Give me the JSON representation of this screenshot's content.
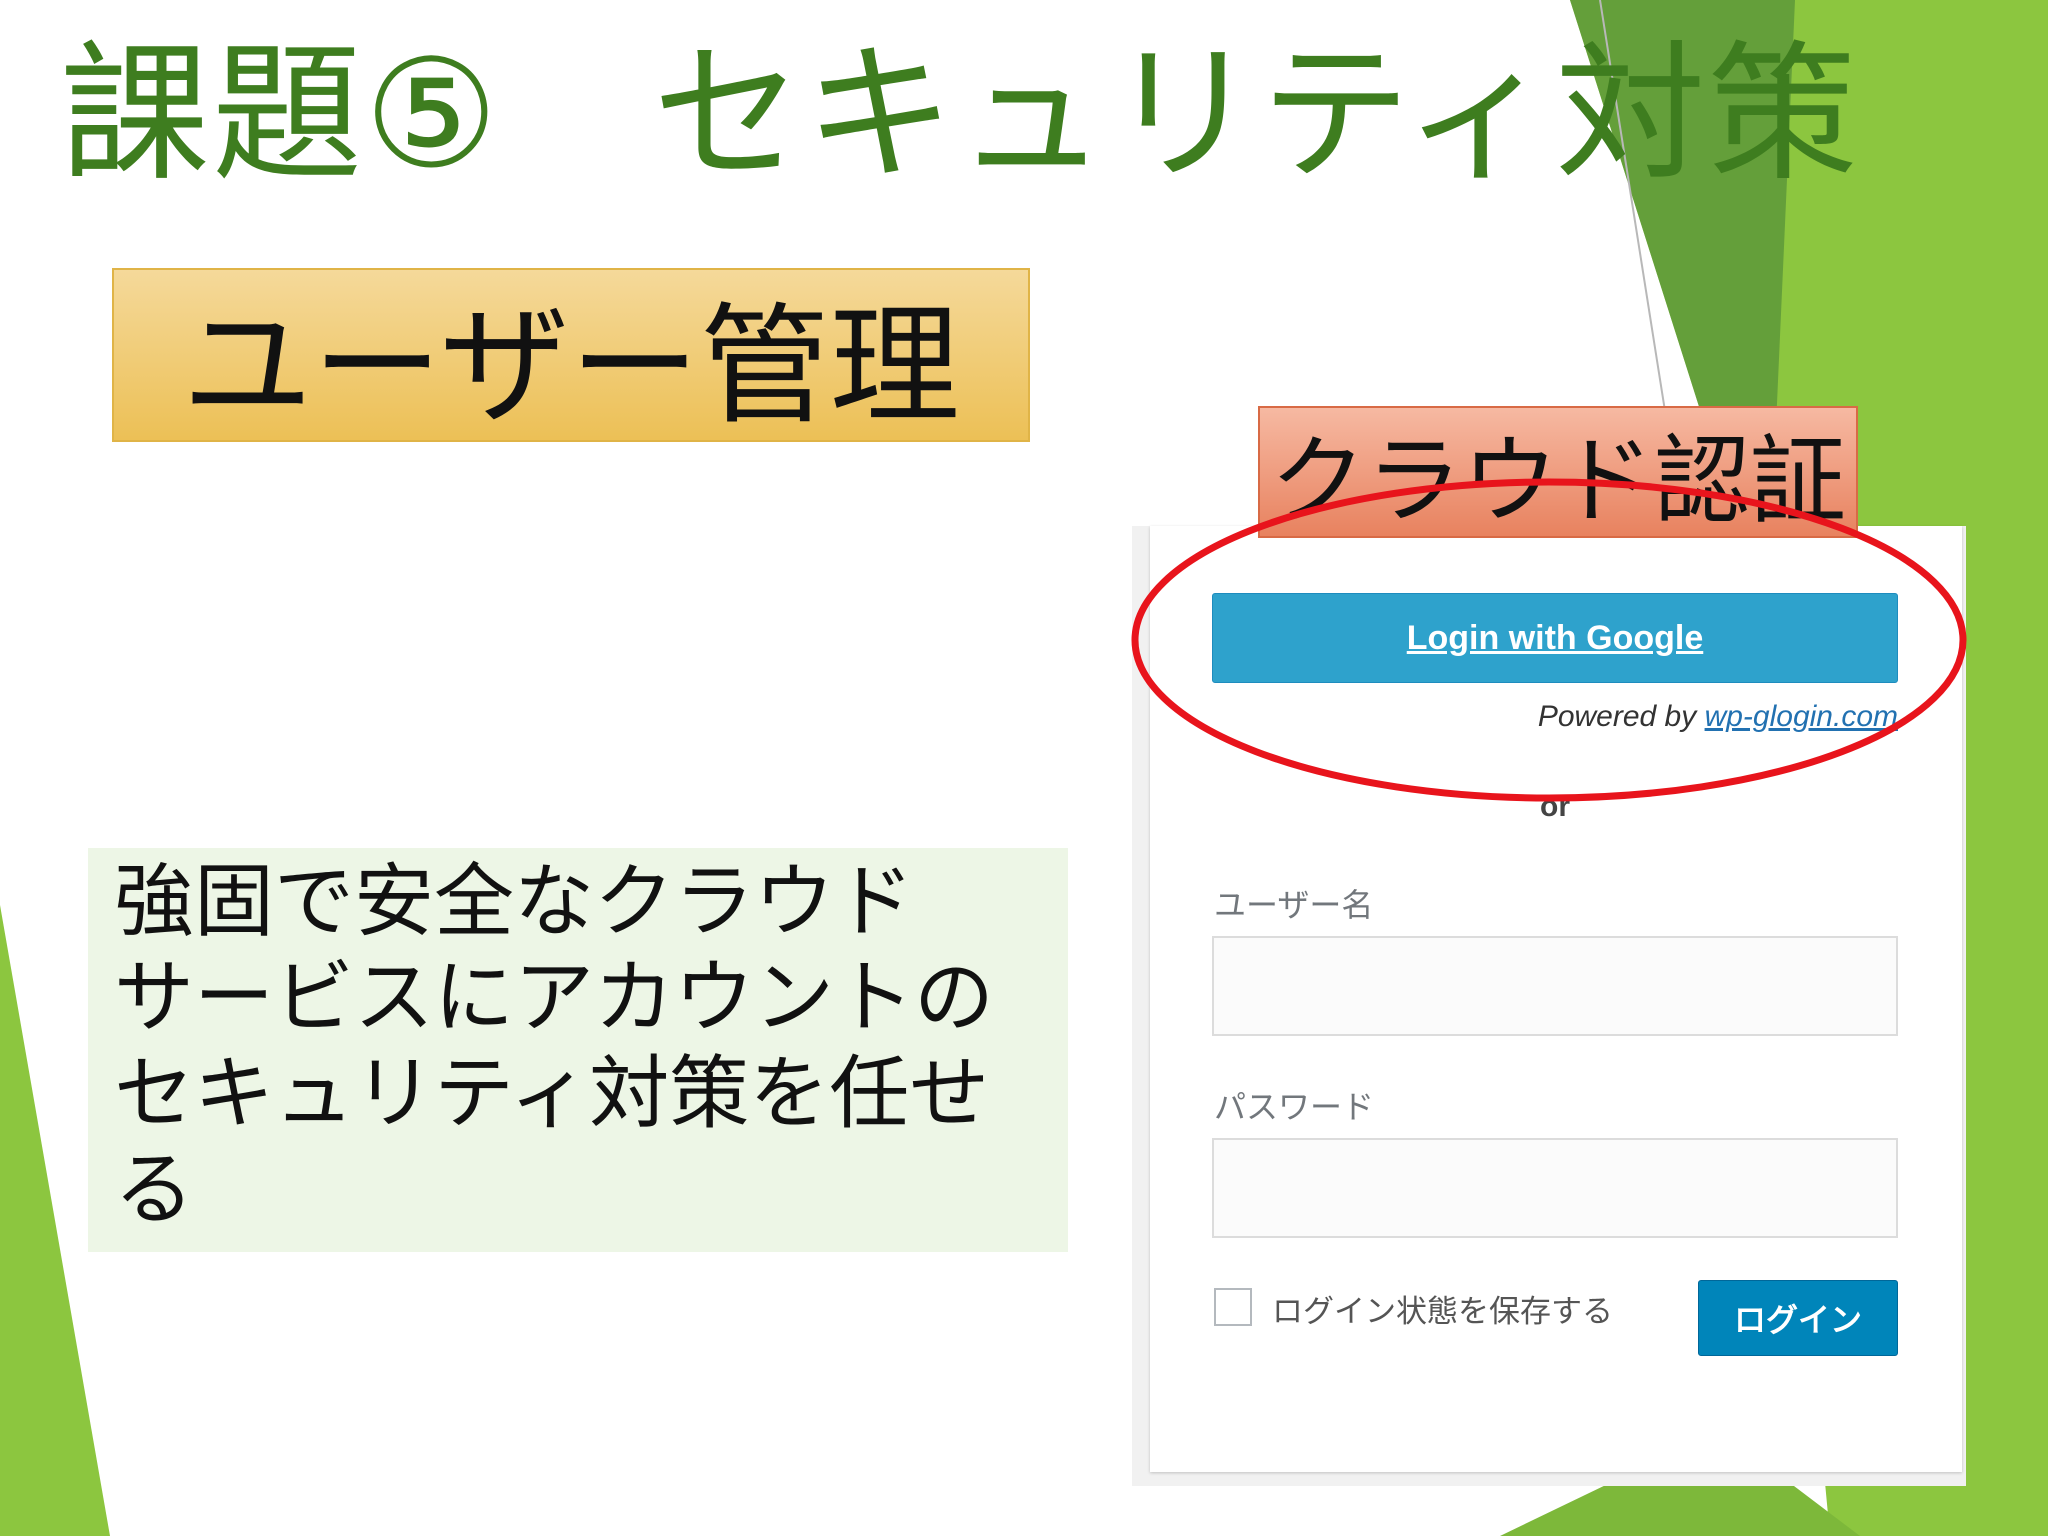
{
  "slide": {
    "title": "課題⑤　セキュリティ対策",
    "section_box": "ユーザー管理",
    "callout": "クラウド認証",
    "description_lines": [
      "強固で安全なクラウド",
      "サービスにアカウントの",
      "セキュリティ対策を任せ",
      "る"
    ]
  },
  "login_form": {
    "google_button": "Login with Google",
    "powered_prefix": "Powered by ",
    "powered_link": "wp-glogin.com",
    "or_text": "or",
    "username_label": "ユーザー名",
    "password_label": "パスワード",
    "remember_label": "ログイン状態を保存する",
    "login_button": "ログイン"
  },
  "colors": {
    "title_green": "#3e7d1f",
    "accent_green": "#8cc63f",
    "dark_green": "#5f9a3a",
    "highlight_red": "#e8141c",
    "google_blue": "#2ea2cc",
    "login_blue": "#0085ba"
  }
}
